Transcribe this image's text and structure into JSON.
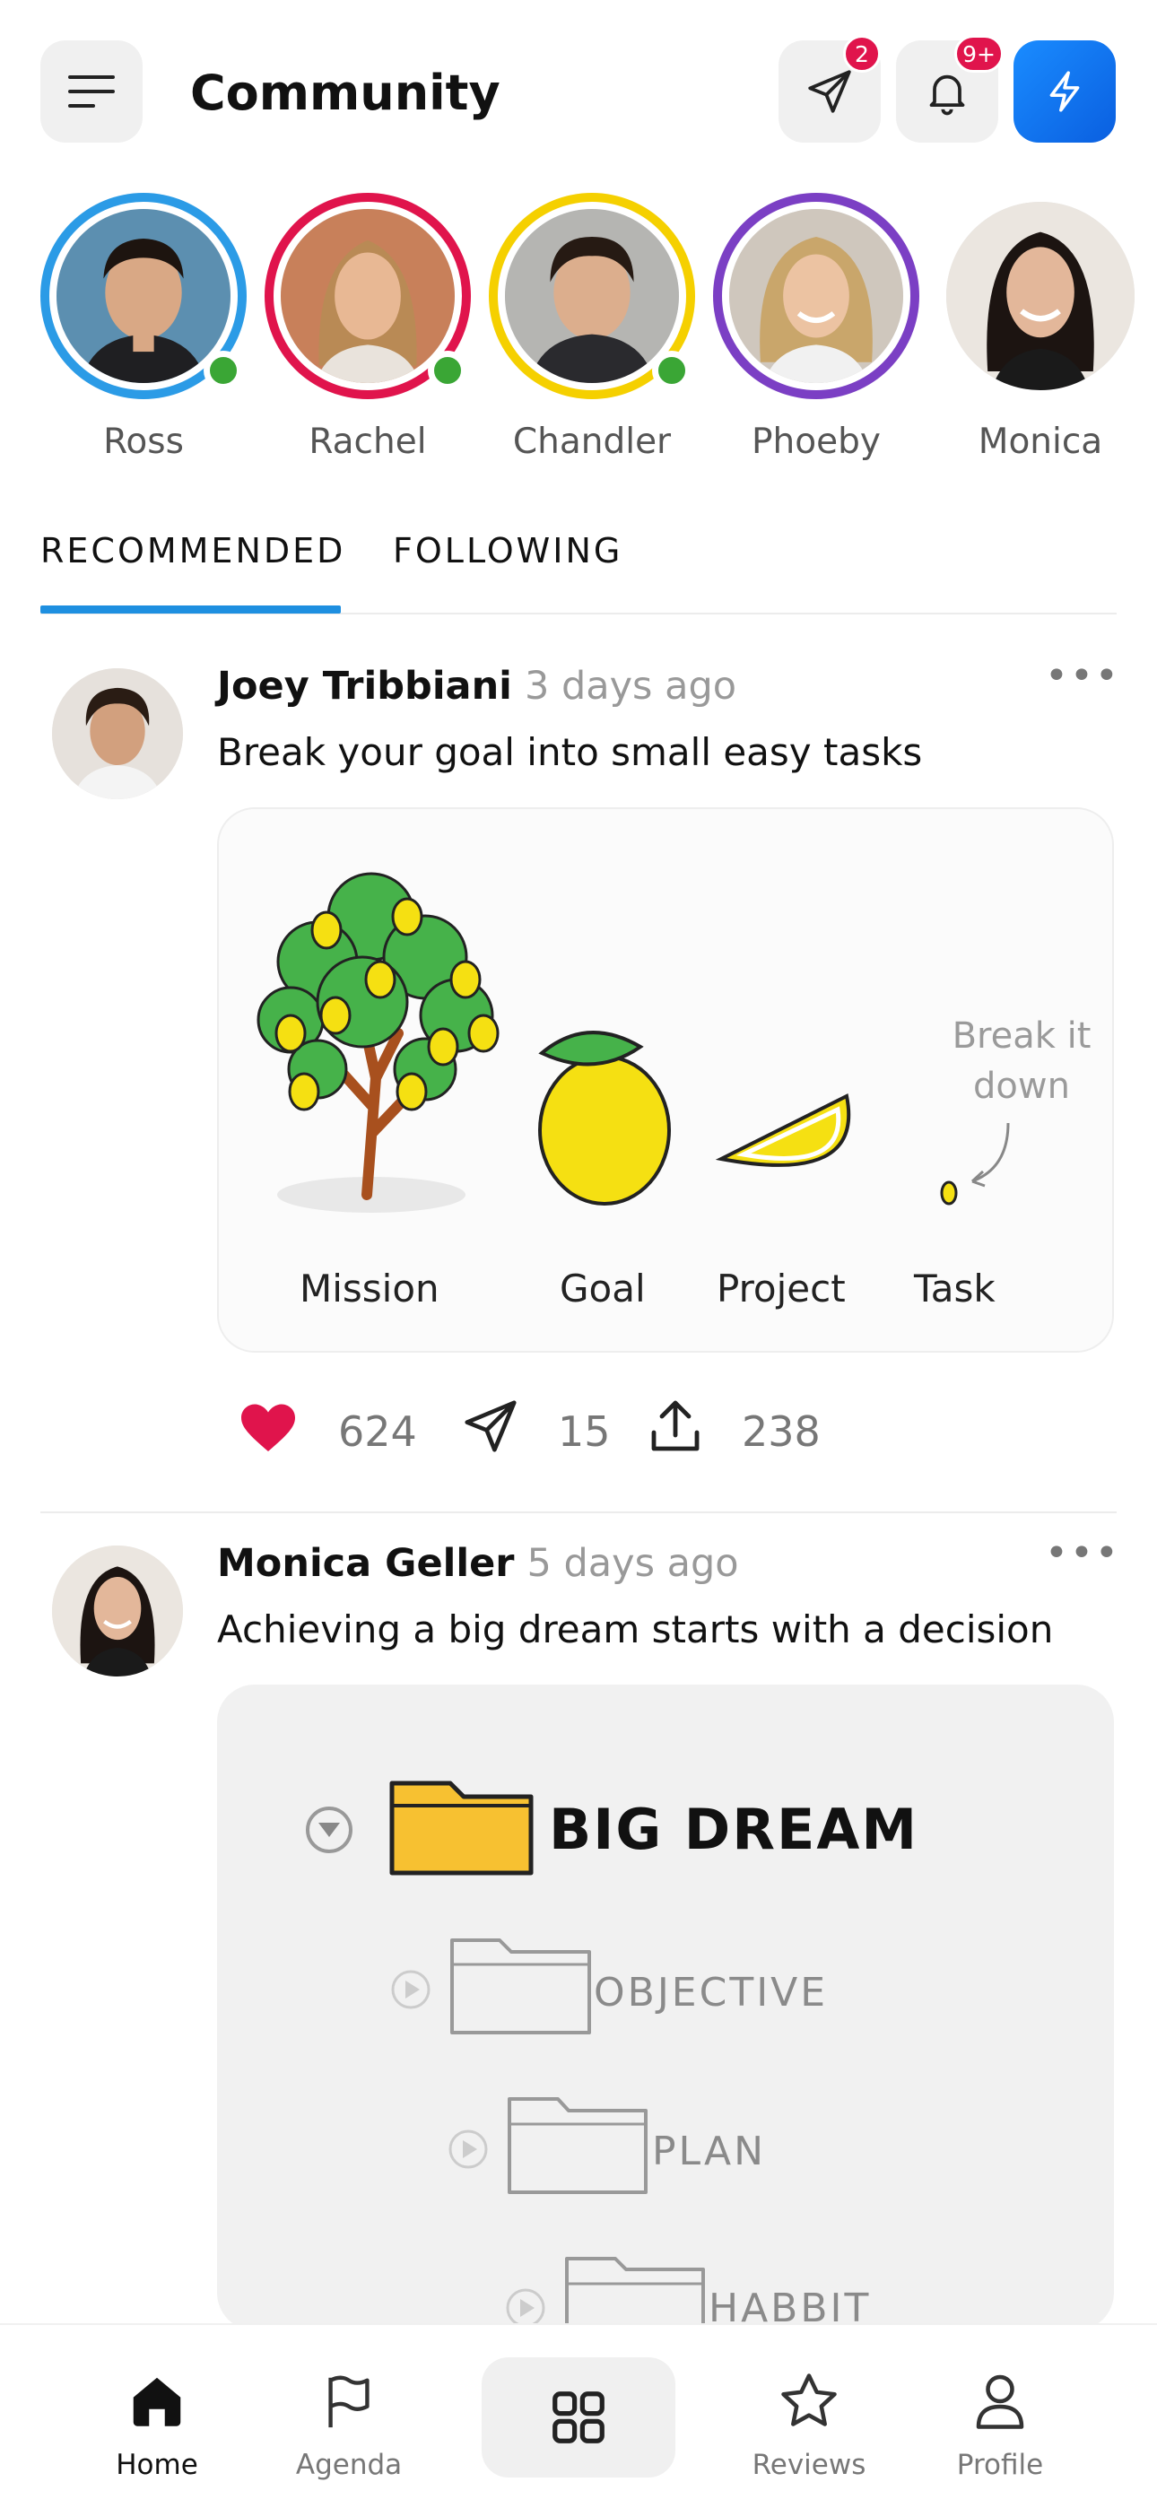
{
  "header": {
    "title": "Community",
    "messages_badge": "2",
    "notifications_badge": "9+",
    "accent_color": "#1a8cff",
    "badge_color": "#e0144c"
  },
  "stories": [
    {
      "name": "Ross",
      "ring_color": "#2b9be6",
      "online": true
    },
    {
      "name": "Rachel",
      "ring_color": "#e0144c",
      "online": true
    },
    {
      "name": "Chandler",
      "ring_color": "#f5d000",
      "online": true
    },
    {
      "name": "Phoeby",
      "ring_color": "#7b3fc4",
      "online": false
    },
    {
      "name": "Monica",
      "ring_color": "none",
      "online": false
    }
  ],
  "tabs": [
    {
      "label": "RECOMMENDED",
      "active": true
    },
    {
      "label": "FOLLOWING",
      "active": false
    }
  ],
  "posts": [
    {
      "author": "Joey Tribbiani",
      "time": "3 days ago",
      "text": "Break your goal into small easy tasks",
      "figure": {
        "labels": [
          "Mission",
          "Goal",
          "Project",
          "Task"
        ],
        "note": "Break it down"
      },
      "likes": "624",
      "shares": "15",
      "uploads": "238"
    },
    {
      "author": "Monica Geller",
      "time": "5 days ago",
      "text": "Achieving a big dream starts with a decision",
      "figure": {
        "items": [
          "BIG DREAM",
          "OBJECTIVE",
          "PLAN",
          "HABBIT"
        ]
      }
    }
  ],
  "bottom_nav": {
    "items": [
      {
        "label": "Home",
        "icon": "home-icon",
        "active": true
      },
      {
        "label": "Agenda",
        "icon": "flag-icon",
        "active": false
      },
      {
        "label": "",
        "icon": "grid-icon",
        "active": false
      },
      {
        "label": "Reviews",
        "icon": "star-icon",
        "active": false
      },
      {
        "label": "Profile",
        "icon": "user-icon",
        "active": false
      }
    ]
  }
}
